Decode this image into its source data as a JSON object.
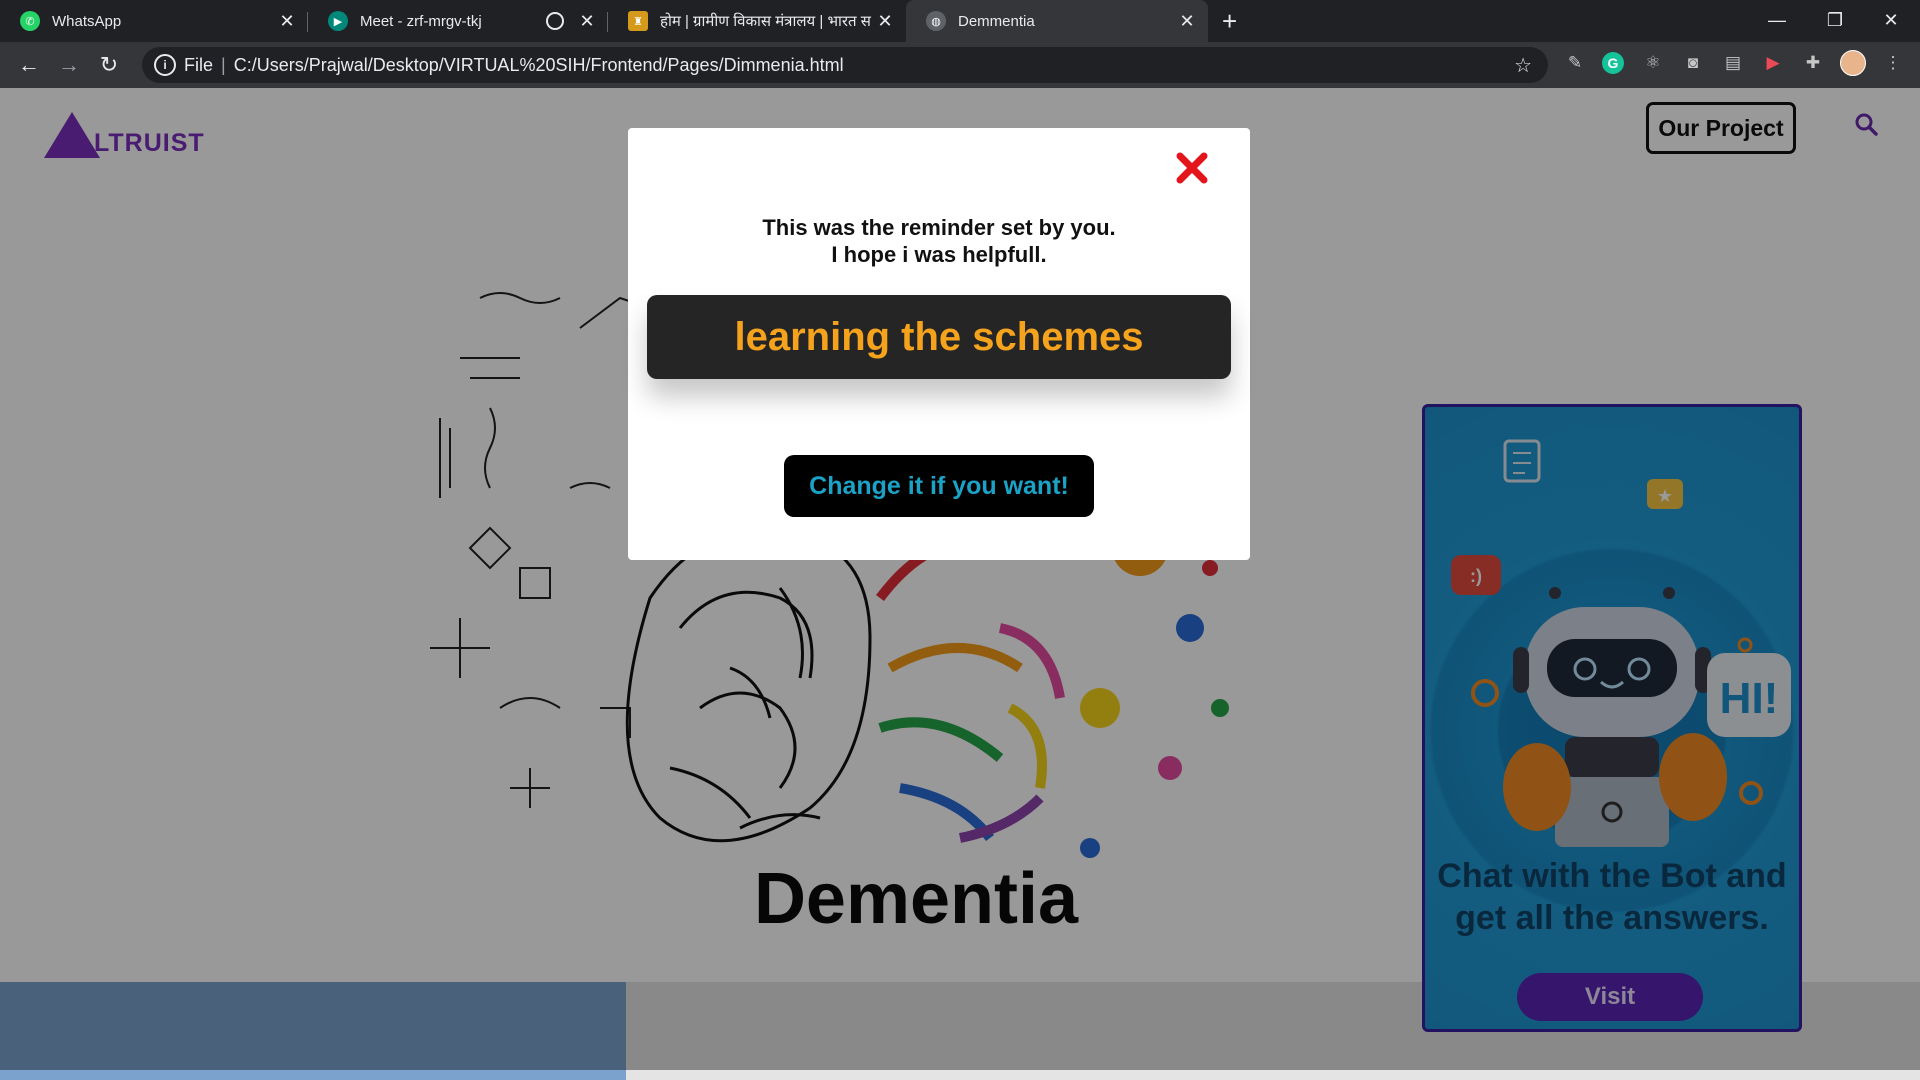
{
  "browser": {
    "tabs": [
      {
        "title": "WhatsApp",
        "icon": "whatsapp-icon"
      },
      {
        "title": "Meet - zrf-mrgv-tkj",
        "icon": "meet-icon"
      },
      {
        "title": "होम | ग्रामीण विकास मंत्रालय | भारत स",
        "icon": "emblem-icon"
      },
      {
        "title": "Demmentia",
        "icon": "globe-icon"
      }
    ],
    "address": {
      "scheme_label": "File",
      "url": "C:/Users/Prajwal/Desktop/VIRTUAL%20SIH/Frontend/Pages/Dimmenia.html"
    }
  },
  "page": {
    "brand": "LTRUIST",
    "nav_button": "Our Project",
    "heading": "Dementia",
    "chatbot": {
      "text": "Chat with the Bot and get all the answers.",
      "visit_label": "Visit",
      "bubble_text": "HI!",
      "emoji_text": ":)"
    }
  },
  "modal": {
    "message_line1": "This was the reminder set by you.",
    "message_line2": "I hope i was helpfull.",
    "reminder_text": "learning the schemes",
    "change_label": "Change it if you want!"
  },
  "colors": {
    "brand": "#7b2fbf",
    "reminder_text": "#f5a21c",
    "change_text": "#1aa3c7",
    "close_icon": "#e3161b",
    "visit_button": "#5a23b5"
  }
}
